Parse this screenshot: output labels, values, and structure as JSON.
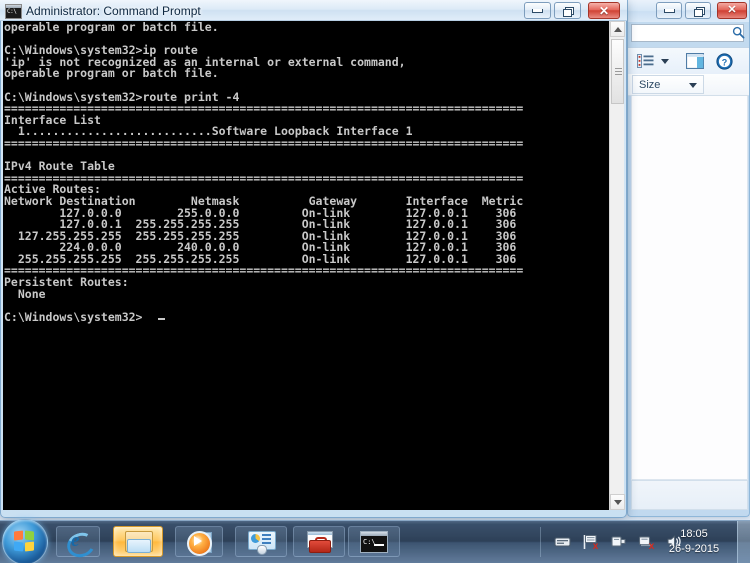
{
  "cmd_window": {
    "title": "Administrator: Command Prompt",
    "icon_name": "console-icon",
    "icon_text": "C:\\",
    "buttons": {
      "minimize": "Minimize",
      "maximize": "Maximize",
      "close": "Close",
      "close_glyph": "✕"
    },
    "console_text": "operable program or batch file.\n\nC:\\Windows\\system32>ip route\n'ip' is not recognized as an internal or external command,\noperable program or batch file.\n\nC:\\Windows\\system32>route print -4\n===========================================================================\nInterface List\n  1...........................Software Loopback Interface 1\n===========================================================================\n\nIPv4 Route Table\n===========================================================================\nActive Routes:\nNetwork Destination        Netmask          Gateway       Interface  Metric\n        127.0.0.0        255.0.0.0         On-link        127.0.0.1    306\n        127.0.0.1  255.255.255.255         On-link        127.0.0.1    306\n  127.255.255.255  255.255.255.255         On-link        127.0.0.1    306\n        224.0.0.0        240.0.0.0         On-link        127.0.0.1    306\n  255.255.255.255  255.255.255.255         On-link        127.0.0.1    306\n===========================================================================\nPersistent Routes:\n  None\n\nC:\\Windows\\system32>",
    "scrollbar": {
      "up_label": "Scroll up",
      "down_label": "Scroll down",
      "thumb_label": "Scroll thumb"
    },
    "colors": {
      "background": "#000000",
      "foreground": "#c8c8c8"
    }
  },
  "explorer_window": {
    "buttons": {
      "minimize": "Minimize",
      "maximize": "Maximize",
      "close": "Close",
      "close_glyph": "✕"
    },
    "search": {
      "value": "",
      "placeholder": ""
    },
    "toolbar": {
      "views_label": "Change your view",
      "views_arrow_label": "More options",
      "preview_label": "Show the preview pane",
      "help_label": "Get help"
    },
    "column_header": {
      "size_label": "Size"
    }
  },
  "taskbar": {
    "start_label": "Start",
    "buttons": [
      {
        "label": "Internet Explorer",
        "icon": "internet-explorer-icon",
        "active": false
      },
      {
        "label": "Windows Explorer",
        "icon": "folder-icon",
        "active": true
      },
      {
        "label": "Windows Media Player",
        "icon": "media-player-icon",
        "active": false
      },
      {
        "label": "Control Panel",
        "icon": "control-panel-icon",
        "active": false
      },
      {
        "label": "System Tools",
        "icon": "toolbox-icon",
        "active": false
      },
      {
        "label": "Command Prompt",
        "icon": "command-prompt-icon",
        "active": false
      }
    ],
    "tray_icons": [
      {
        "label": "Tablet PC Input Panel",
        "icon": "keyboard-icon"
      },
      {
        "label": "Action Center",
        "icon": "flag-icon",
        "badge": "x"
      },
      {
        "label": "Safely Remove Hardware",
        "icon": "usb-eject-icon"
      },
      {
        "label": "Network",
        "icon": "network-icon",
        "badge": "x"
      },
      {
        "label": "Volume",
        "icon": "speaker-icon"
      }
    ],
    "clock": {
      "time": "18:05",
      "date": "26-9-2015"
    },
    "show_desktop_label": "Show desktop"
  }
}
